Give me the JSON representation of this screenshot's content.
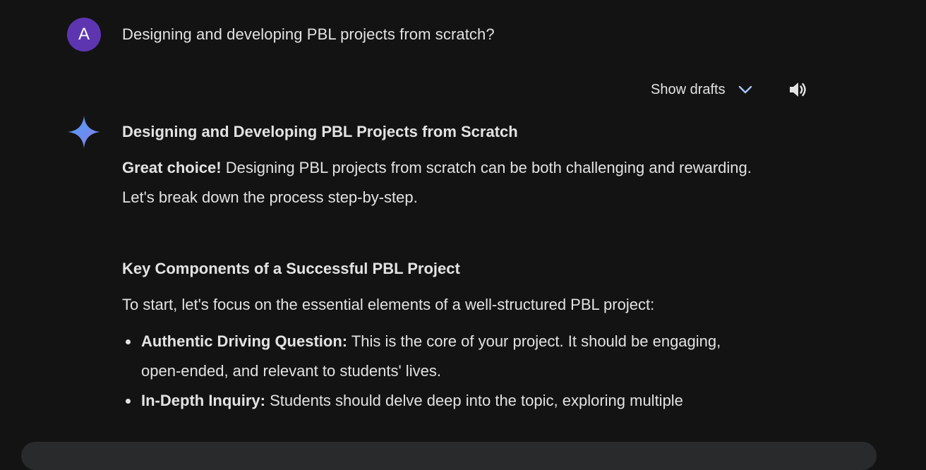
{
  "user": {
    "avatar_letter": "A",
    "avatar_color": "#5e35b1",
    "query": "Designing and developing PBL projects from scratch?"
  },
  "toolbar": {
    "show_drafts_label": "Show drafts",
    "expand_icon": "chevron-down-icon",
    "read_aloud_icon": "speaker-icon",
    "accent_color": "#a8c7fa"
  },
  "response": {
    "assistant_icon": "sparkle-icon",
    "title": "Designing and Developing PBL Projects from Scratch",
    "intro_bold": "Great choice!",
    "intro_text": " Designing PBL projects from scratch can be both challenging and rewarding. Let's break down the process step-by-step.",
    "section_heading": "Key Components of a Successful PBL Project",
    "section_lead": "To start, let's focus on the essential elements of a well-structured PBL project:",
    "points": [
      {
        "term": "Authentic Driving Question:",
        "text": " This is the core of your project. It should be engaging, open-ended, and relevant to students' lives."
      },
      {
        "term": "In-Depth Inquiry:",
        "text": " Students should delve deep into the topic, exploring multiple"
      }
    ]
  },
  "colors": {
    "background": "#131313",
    "text": "#e3e3e3",
    "input_bar": "#282a2c"
  }
}
